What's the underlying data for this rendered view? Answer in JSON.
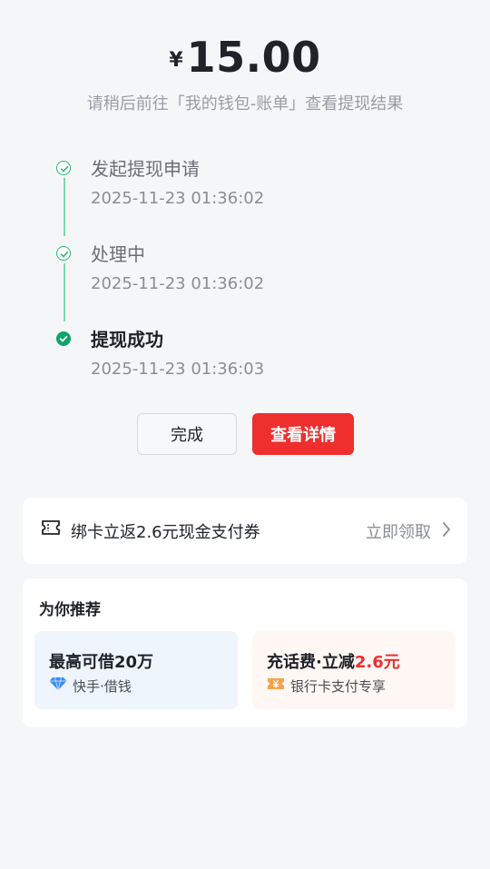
{
  "amount": {
    "currency": "¥",
    "value": "15.00"
  },
  "hint": "请稍后前往「我的钱包-账单」查看提现结果",
  "steps": [
    {
      "title": "发起提现申请",
      "time": "2025-11-23 01:36:02",
      "state": "passed"
    },
    {
      "title": "处理中",
      "time": "2025-11-23 01:36:02",
      "state": "passed"
    },
    {
      "title": "提现成功",
      "time": "2025-11-23 01:36:03",
      "state": "current"
    }
  ],
  "buttons": {
    "done": "完成",
    "detail": "查看详情"
  },
  "coupon": {
    "icon": "ticket-icon",
    "text": "绑卡立返2.6元现金支付券",
    "action": "立即领取"
  },
  "recommend": {
    "heading": "为你推荐",
    "tiles": [
      {
        "title": "最高可借20万",
        "title_highlight": "",
        "icon": "diamond-icon",
        "subtitle": "快手·借钱"
      },
      {
        "title": "充话费·立减",
        "title_highlight": "2.6元",
        "icon": "coupon-icon",
        "subtitle": "银行卡支付专享"
      }
    ]
  },
  "colors": {
    "accent_red": "#ef2e2e",
    "success_green": "#0ea46a"
  }
}
